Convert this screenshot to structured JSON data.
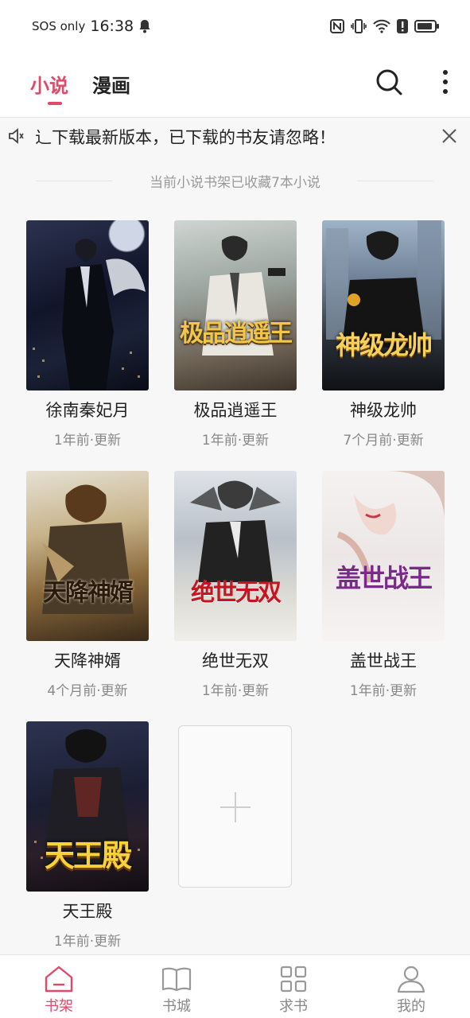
{
  "status_bar": {
    "carrier": "SOS only",
    "time": "16:38"
  },
  "header": {
    "tabs": [
      {
        "label": "小说",
        "active": true
      },
      {
        "label": "漫画",
        "active": false
      }
    ],
    "accent_color": "#e04a6a",
    "search_icon": "search-icon",
    "more_icon": "more-vertical-icon"
  },
  "notice": {
    "text": "⻌下载最新版本，已下载的书友请忽略！"
  },
  "shelf": {
    "info": "当前小说书架已收藏7本小说",
    "books": [
      {
        "title": "徐南秦妃月",
        "meta": "1年前·更新",
        "cover_text": ""
      },
      {
        "title": "极品逍遥王",
        "meta": "1年前·更新",
        "cover_text": "极品逍遥王"
      },
      {
        "title": "神级龙帅",
        "meta": "7个月前·更新",
        "cover_text": "神级龙帅"
      },
      {
        "title": "天降神婿",
        "meta": "4个月前·更新",
        "cover_text": "天降神婿"
      },
      {
        "title": "绝世无双",
        "meta": "1年前·更新",
        "cover_text": "绝世无双"
      },
      {
        "title": "盖世战王",
        "meta": "1年前·更新",
        "cover_text": "盖世战王"
      },
      {
        "title": "天王殿",
        "meta": "1年前·更新",
        "cover_text": "天王殿"
      }
    ]
  },
  "bottom_nav": [
    {
      "label": "书架",
      "icon": "home-icon",
      "active": true
    },
    {
      "label": "书城",
      "icon": "book-icon",
      "active": false
    },
    {
      "label": "求书",
      "icon": "grid-icon",
      "active": false
    },
    {
      "label": "我的",
      "icon": "person-icon",
      "active": false
    }
  ]
}
